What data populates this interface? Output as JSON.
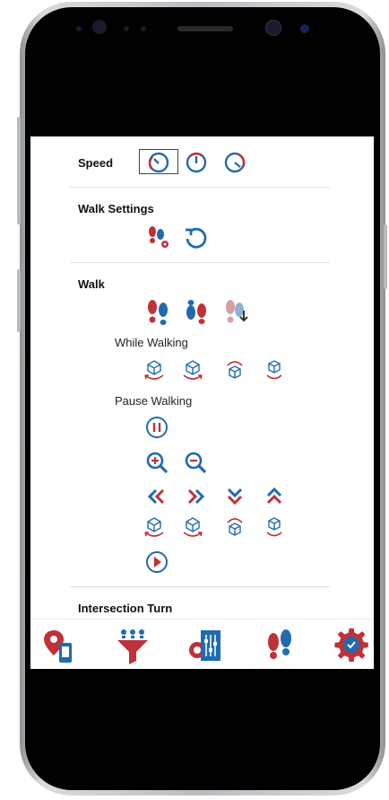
{
  "sections": {
    "speed": {
      "title": "Speed",
      "icons": [
        "speed-slow-icon",
        "speed-medium-icon",
        "speed-fast-icon"
      ]
    },
    "walk_settings": {
      "title": "Walk Settings",
      "icons": [
        "footprints-settings-icon",
        "reset-icon"
      ]
    },
    "walk": {
      "title": "Walk",
      "icons": [
        "footprints-forward-icon",
        "footprints-alternate-icon",
        "footprints-download-icon"
      ],
      "while_walking": {
        "title": "While Walking",
        "icons": [
          "rotate-cube-left-icon",
          "rotate-cube-right-icon",
          "tilt-cube-up-icon",
          "tilt-cube-down-icon"
        ]
      },
      "pause_walking": {
        "title": "Pause Walking",
        "icons": [
          "pause-icon",
          "zoom-in-icon",
          "zoom-out-icon",
          "double-chevron-left-icon",
          "double-chevron-right-icon",
          "double-chevron-down-icon",
          "double-chevron-up-icon",
          "rotate-cube-left-icon",
          "rotate-cube-right-icon",
          "tilt-cube-up-icon",
          "tilt-cube-down-icon",
          "play-icon"
        ]
      }
    },
    "intersection_turn": {
      "title": "Intersection Turn"
    }
  },
  "navbar": [
    "location-phone-icon",
    "filter-funnel-icon",
    "control-settings-icon",
    "footprints-icon",
    "settings-gear-icon"
  ],
  "colors": {
    "red": "#c0313a",
    "blue": "#1f6bb0",
    "selected_border": "#444444"
  }
}
